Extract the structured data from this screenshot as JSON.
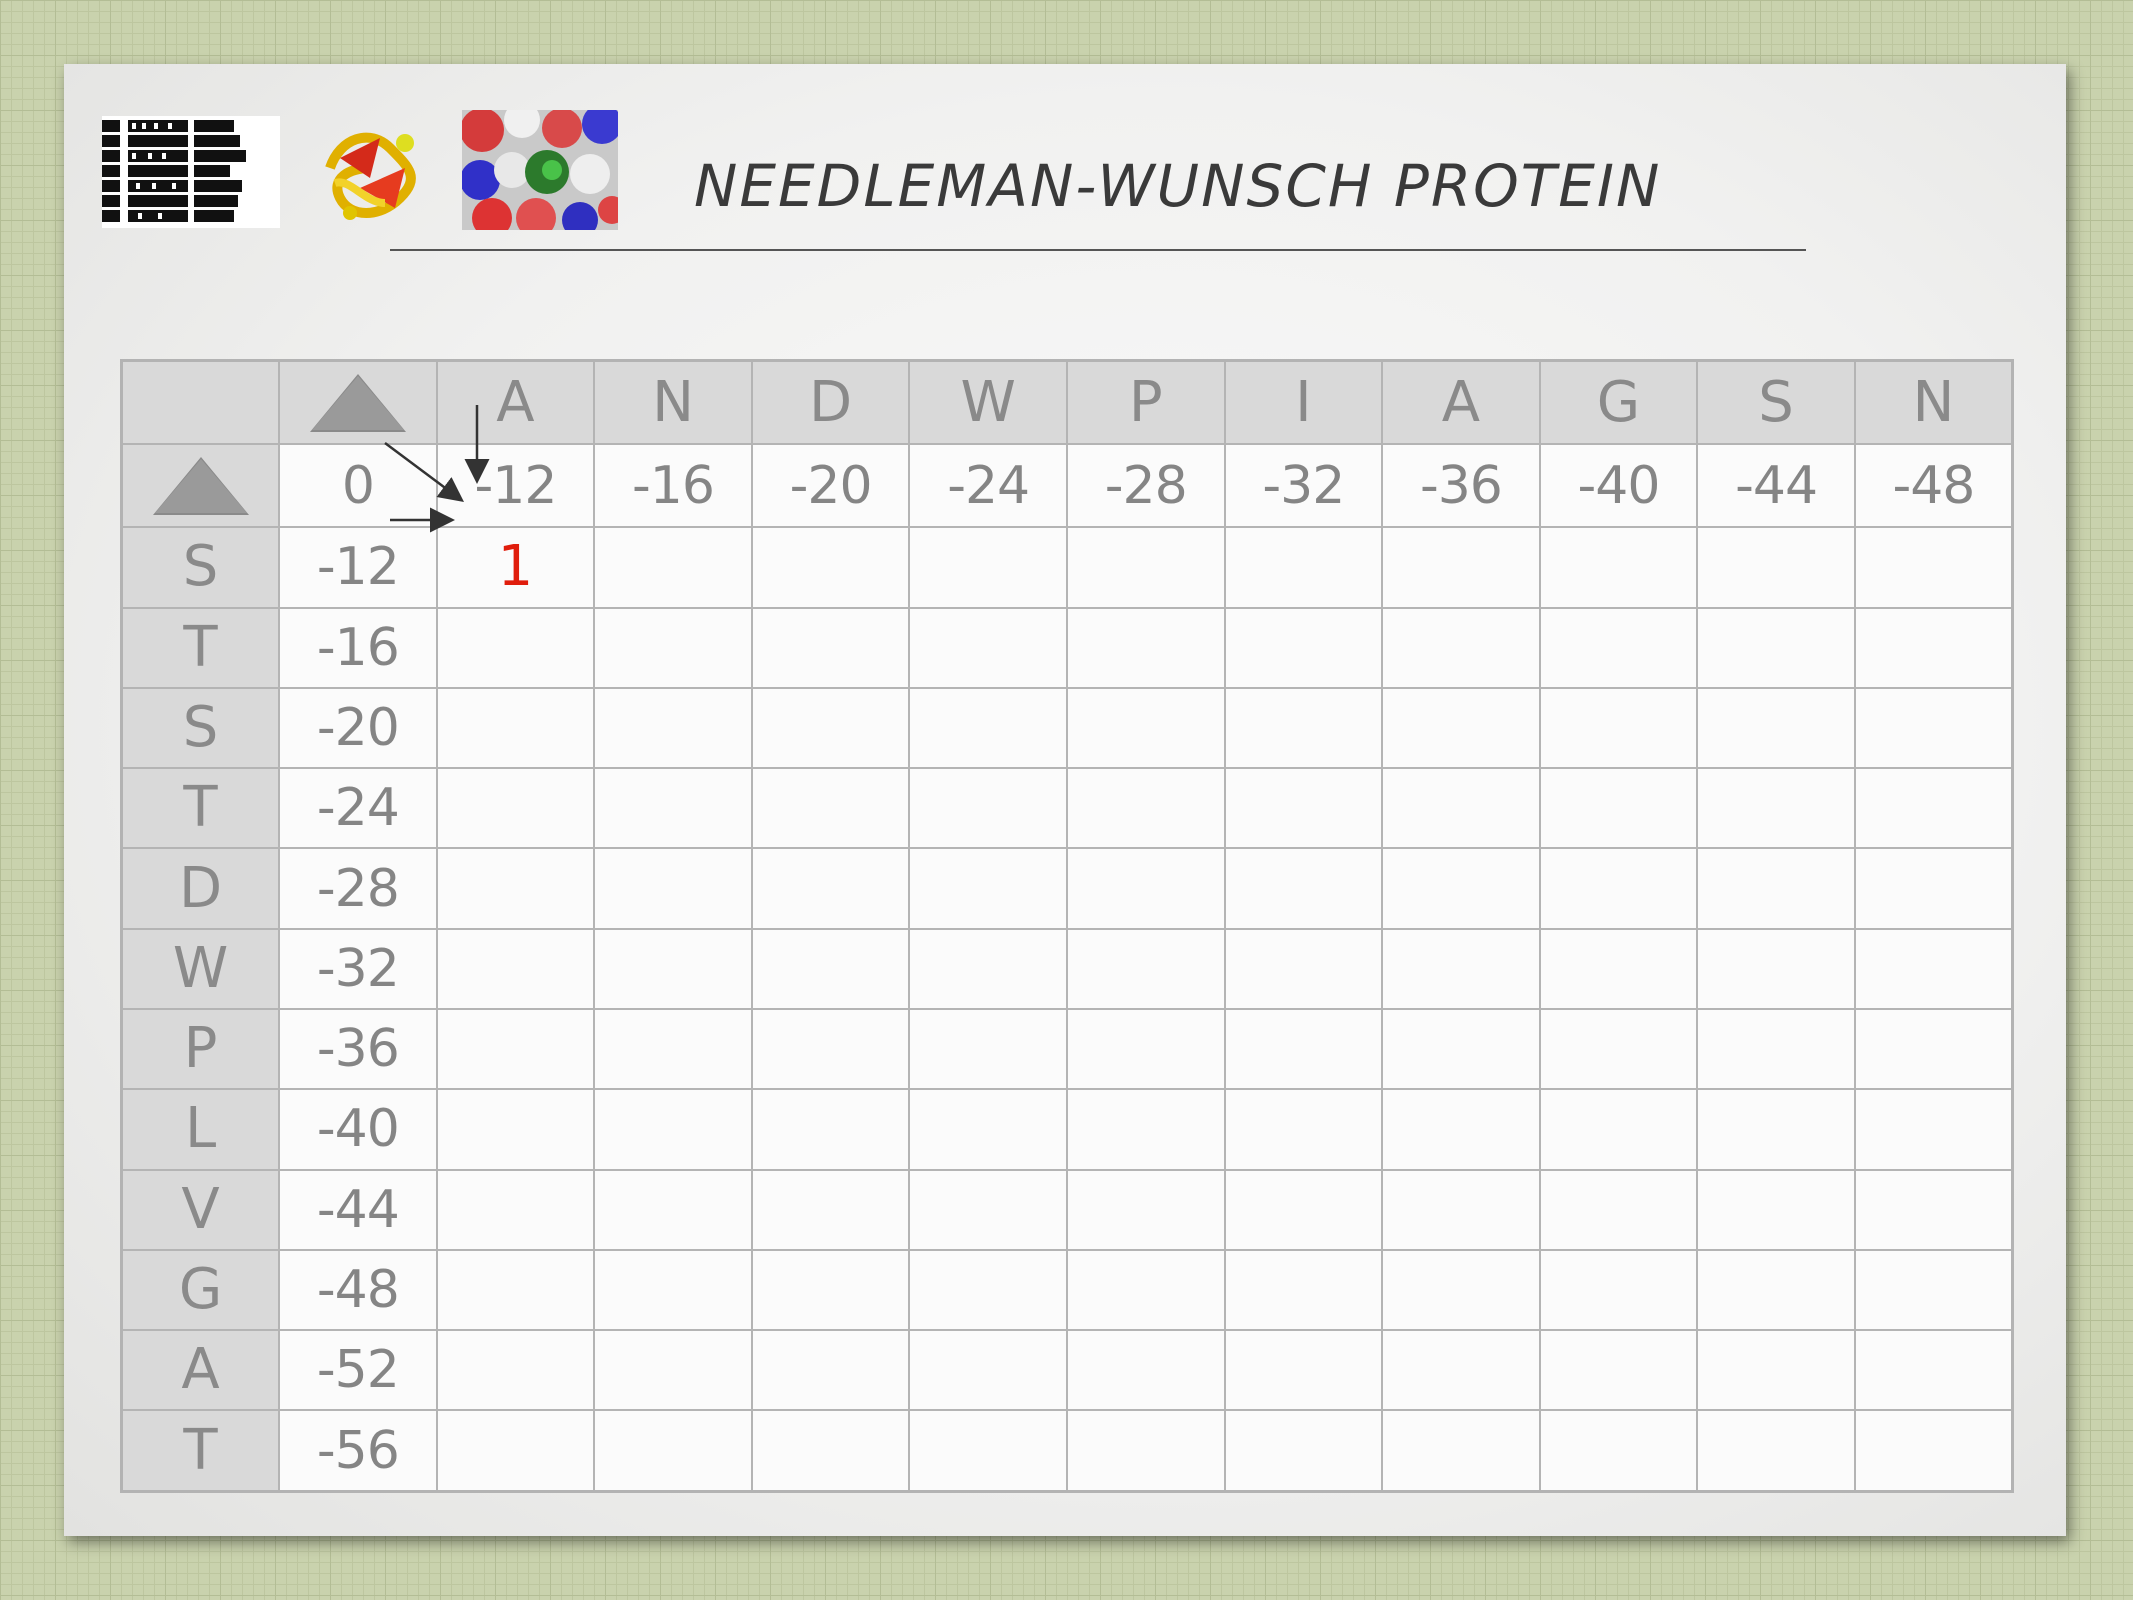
{
  "slide": {
    "title": "NEEDLEMAN-WUNSCH PROTEIN"
  },
  "matrix": {
    "column_residues": [
      "A",
      "N",
      "D",
      "W",
      "P",
      "I",
      "A",
      "G",
      "S",
      "N"
    ],
    "row_residues": [
      "S",
      "T",
      "S",
      "T",
      "D",
      "W",
      "P",
      "L",
      "V",
      "G",
      "A",
      "T"
    ],
    "top_row_scores": [
      "0",
      "-12",
      "-16",
      "-20",
      "-24",
      "-28",
      "-32",
      "-36",
      "-40",
      "-44",
      "-48"
    ],
    "left_column_scores": [
      "-12",
      "-16",
      "-20",
      "-24",
      "-28",
      "-32",
      "-36",
      "-40",
      "-44",
      "-48",
      "-52",
      "-56"
    ],
    "filled_cells": [
      {
        "row": 0,
        "col": 0,
        "value": "1"
      }
    ],
    "gap_symbol": "gap-triangle",
    "colors": {
      "text": "#8a8a8a",
      "header_bg": "#d9d9d9",
      "highlight_value": "#e01d0c"
    }
  }
}
